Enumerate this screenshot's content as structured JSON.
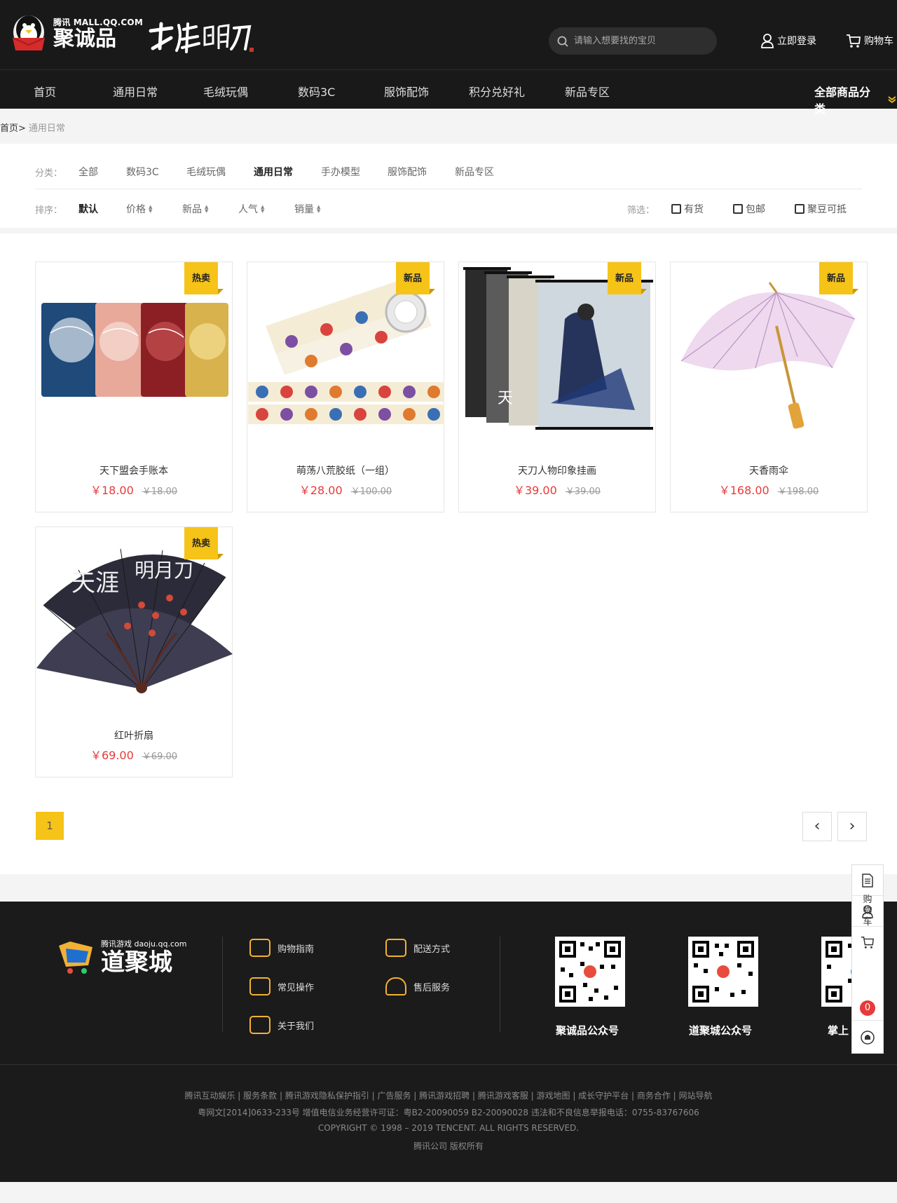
{
  "header": {
    "logo_small": "腾讯 MALL.QQ.COM",
    "logo_big": "聚诚品",
    "search_placeholder": "请输入想要找的宝贝",
    "login_label": "立即登录",
    "cart_label": "购物车"
  },
  "nav": {
    "items": [
      "首页",
      "通用日常",
      "毛绒玩偶",
      "数码3C",
      "服饰配饰",
      "积分兑好礼",
      "新品专区"
    ],
    "all_label": "全部商品分类"
  },
  "breadcrumb": {
    "home": "首页>",
    "current": "通用日常"
  },
  "filters": {
    "category_label": "分类：",
    "categories": [
      "全部",
      "数码3C",
      "毛绒玩偶",
      "通用日常",
      "手办模型",
      "服饰配饰",
      "新品专区"
    ],
    "active_category": "通用日常",
    "sort_label": "排序：",
    "sorts": [
      "默认",
      "价格",
      "新品",
      "人气",
      "销量"
    ],
    "screen_label": "筛选：",
    "checks": [
      "有货",
      "包邮",
      "聚豆可抵"
    ]
  },
  "products": [
    {
      "name": "天下盟会手账本",
      "price": "￥18.00",
      "old_price": "￥18.00",
      "badge": "热卖"
    },
    {
      "name": "萌荡八荒胶纸（一组）",
      "price": "￥28.00",
      "old_price": "￥100.00",
      "badge": "新品"
    },
    {
      "name": "天刀人物印象挂画",
      "price": "￥39.00",
      "old_price": "￥39.00",
      "badge": "新品"
    },
    {
      "name": "天香雨伞",
      "price": "￥168.00",
      "old_price": "￥198.00",
      "badge": "新品"
    },
    {
      "name": "红叶折扇",
      "price": "￥69.00",
      "old_price": "￥69.00",
      "badge": "热卖"
    }
  ],
  "pagination": {
    "current": "1",
    "prev": "‹",
    "next": "›"
  },
  "footer": {
    "brand_small": "腾讯游戏 daoju.qq.com",
    "brand_big": "道聚城",
    "links": [
      "购物指南",
      "配送方式",
      "常见操作",
      "售后服务",
      "关于我们"
    ],
    "qr_labels": [
      "聚诚品公众号",
      "道聚城公众号",
      "掌上"
    ],
    "legal": [
      "腾讯互动娱乐 | 服务条款 | 腾讯游戏隐私保护指引 | 广告服务 | 腾讯游戏招聘 | 腾讯游戏客服 | 游戏地图 | 成长守护平台 | 商务合作 | 网站导航",
      "粤网文[2014]0633-233号 增值电信业务经营许可证：粤B2-20090059 B2-20090028 违法和不良信息举报电话：0755-83767606",
      "COPYRIGHT © 1998 – 2019 TENCENT. ALL RIGHTS RESERVED.",
      "腾讯公司 版权所有"
    ]
  },
  "sidebar": {
    "cart_text": "购物车",
    "cart_count": "0"
  },
  "colors": {
    "accent": "#f6c318",
    "price": "#e73a3a",
    "dark": "#191919"
  }
}
